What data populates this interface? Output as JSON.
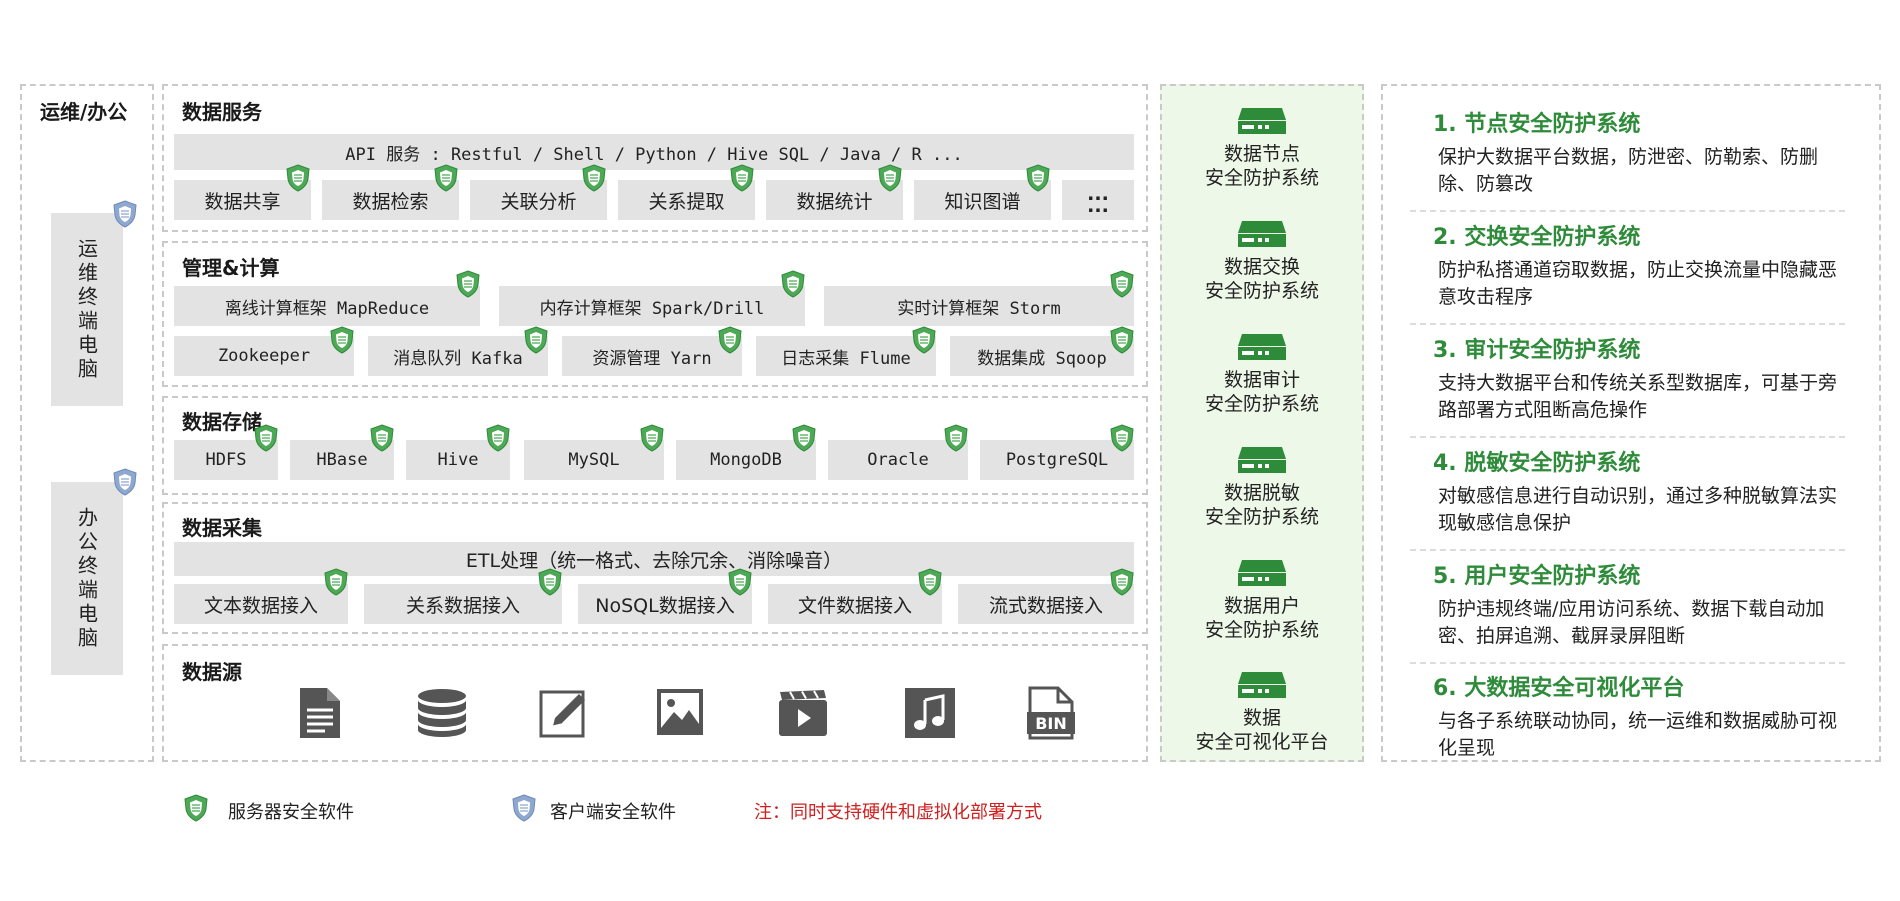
{
  "left": {
    "title": "运维/办公",
    "terminals": [
      "运维终端电脑",
      "办公终端电脑"
    ]
  },
  "layers": {
    "service": {
      "title": "数据服务",
      "api": "API 服务 : Restful / Shell / Python / Hive SQL / Java / R ...",
      "items": [
        "数据共享",
        "数据检索",
        "关联分析",
        "关系提取",
        "数据统计",
        "知识图谱"
      ],
      "more": "..."
    },
    "compute": {
      "title": "管理&计算",
      "row1": [
        "离线计算框架 MapReduce",
        "内存计算框架 Spark/Drill",
        "实时计算框架 Storm"
      ],
      "row2": [
        "Zookeeper",
        "消息队列 Kafka",
        "资源管理 Yarn",
        "日志采集 Flume",
        "数据集成 Sqoop"
      ]
    },
    "storage": {
      "title": "数据存储",
      "items": [
        "HDFS",
        "HBase",
        "Hive",
        "MySQL",
        "MongoDB",
        "Oracle",
        "PostgreSQL"
      ]
    },
    "collect": {
      "title": "数据采集",
      "etl": "ETL处理（统一格式、去除冗余、消除噪音）",
      "items": [
        "文本数据接入",
        "关系数据接入",
        "NoSQL数据接入",
        "文件数据接入",
        "流式数据接入"
      ]
    },
    "source": {
      "title": "数据源",
      "icons": [
        "document-icon",
        "database-icon",
        "edit-icon",
        "image-icon",
        "video-icon",
        "music-icon",
        "bin-file-icon"
      ]
    }
  },
  "security_column": [
    {
      "line1": "数据节点",
      "line2": "安全防护系统"
    },
    {
      "line1": "数据交换",
      "line2": "安全防护系统"
    },
    {
      "line1": "数据审计",
      "line2": "安全防护系统"
    },
    {
      "line1": "数据脱敏",
      "line2": "安全防护系统"
    },
    {
      "line1": "数据用户",
      "line2": "安全防护系统"
    },
    {
      "line1": "数据",
      "line2": "安全可视化平台"
    }
  ],
  "descriptions": [
    {
      "title": "1. 节点安全防护系统",
      "text": "保护大数据平台数据，防泄密、防勒索、防删除、防篡改"
    },
    {
      "title": "2.  交换安全防护系统",
      "text": "防护私搭通道窃取数据，防止交换流量中隐藏恶意攻击程序"
    },
    {
      "title": "3.  审计安全防护系统",
      "text": "支持大数据平台和传统关系型数据库，可基于旁路部署方式阻断高危操作"
    },
    {
      "title": "4.  脱敏安全防护系统",
      "text": "对敏感信息进行自动识别，通过多种脱敏算法实现敏感信息保护"
    },
    {
      "title": "5.  用户安全防护系统",
      "text": "防护违规终端/应用访问系统、数据下载自动加密、拍屏追溯、截屏录屏阻断"
    },
    {
      "title": "6.  大数据安全可视化平台",
      "text": "与各子系统联动协同，统一运维和数据威胁可视化呈现"
    }
  ],
  "legend": {
    "server": "服务器安全软件",
    "client": "客户端安全软件",
    "note": "注：同时支持硬件和虚拟化部署方式"
  },
  "colors": {
    "green": "#2e8b3a",
    "shield_green": "#4ea957",
    "shield_blue": "#8fa8cf",
    "note_red": "#d02020",
    "box_gray": "#e3e3e3"
  }
}
